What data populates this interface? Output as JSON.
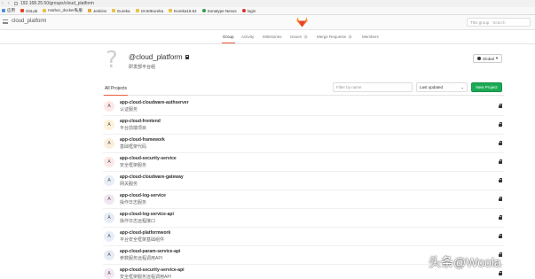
{
  "browser": {
    "url": "192.168.25.50/groups/cloud_platform",
    "bookmarks": [
      {
        "label": "应用",
        "icon": "apps-icon"
      },
      {
        "label": "GitLab",
        "icon": "gitlab-icon"
      },
      {
        "label": "Harbor_docker私服",
        "icon": "folder-icon"
      },
      {
        "label": "Jenkins",
        "icon": "jenkins-icon"
      },
      {
        "label": "Eureka",
        "icon": "folder-icon"
      },
      {
        "label": "19.50Eureka",
        "icon": "folder-icon"
      },
      {
        "label": "Eureka19.54",
        "icon": "folder-icon"
      },
      {
        "label": "Sonatype Nexus",
        "icon": "nexus-icon"
      },
      {
        "label": "login",
        "icon": "login-icon"
      }
    ]
  },
  "header": {
    "group_name": "cloud_platform",
    "search_scope": "This group",
    "search_placeholder": "Search"
  },
  "tabs": [
    {
      "label": "Group",
      "active": true
    },
    {
      "label": "Activity"
    },
    {
      "label": "Milestones"
    },
    {
      "label": "Issues",
      "badge": "0"
    },
    {
      "label": "Merge Requests",
      "badge": "0"
    },
    {
      "label": "Members"
    }
  ],
  "group": {
    "title": "@cloud_platform",
    "description": "研发部平台组",
    "visibility": "Global"
  },
  "projects_header": {
    "tab": "All Projects",
    "filter_placeholder": "Filter by name",
    "sort": "Last updated",
    "new_project": "New Project"
  },
  "projects": [
    {
      "letter": "A",
      "name": "app-cloud-cloudware-authserver",
      "desc": "认证服务",
      "color": "#fde8e8"
    },
    {
      "letter": "A",
      "name": "app-cloud-frontend",
      "desc": "平台前端项目",
      "color": "#fdf2d9"
    },
    {
      "letter": "A",
      "name": "app-cloud-framework",
      "desc": "基础框架代码",
      "color": "#fbeedd"
    },
    {
      "letter": "A",
      "name": "app-cloud-security-service",
      "desc": "安全框架服务",
      "color": "#fde8e8"
    },
    {
      "letter": "A",
      "name": "app-cloud-cloudware-gateway",
      "desc": "网关服务",
      "color": "#e8eef8"
    },
    {
      "letter": "A",
      "name": "app-cloud-log-service",
      "desc": "操作日志服务",
      "color": "#f3e6f3"
    },
    {
      "letter": "A",
      "name": "app-cloud-log-service-api",
      "desc": "操作日志远程接口",
      "color": "#e6ecf6"
    },
    {
      "letter": "A",
      "name": "app-cloud-platformwork",
      "desc": "平台安全框架基础组件",
      "color": "#e8eef8"
    },
    {
      "letter": "A",
      "name": "app-cloud-param-service-api",
      "desc": "参数服务远程调用API",
      "color": "#e6ecf6"
    },
    {
      "letter": "A",
      "name": "app-cloud-security-service-api",
      "desc": "安全框架服务远程调用API",
      "color": "#f3e6f3"
    }
  ],
  "watermark": "头条@Woola"
}
